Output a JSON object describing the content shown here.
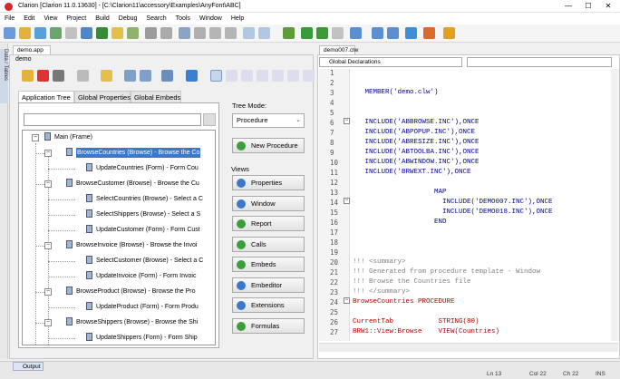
{
  "window": {
    "title": "Clarion [Clarion 11.0.13630] - [C:\\Clarion11\\accessory\\Examples\\AnyFont\\ABC]",
    "min": "—",
    "max": "☐",
    "close": "✕"
  },
  "menu": [
    "File",
    "Edit",
    "View",
    "Project",
    "Build",
    "Debug",
    "Search",
    "Tools",
    "Window",
    "Help"
  ],
  "sidebar": {
    "label": "Data / Tables"
  },
  "left_doc": {
    "tab": "demo.app",
    "subtitle": "demo"
  },
  "tabs": [
    "Application Tree",
    "Global Properties",
    "Global Embeds"
  ],
  "tree": {
    "root": "Main (Frame)",
    "items": [
      {
        "label": "BrowseCountries (Browse) - Browse the Co",
        "level": 1,
        "selected": true
      },
      {
        "label": "UpdateCountries (Form) - Form Cou",
        "level": 2
      },
      {
        "label": "BrowseCustomer (Browse) - Browse the Cu",
        "level": 1
      },
      {
        "label": "SelectCountries (Browse) - Select a C",
        "level": 2
      },
      {
        "label": "SelectShippers (Browse) - Select a S",
        "level": 2
      },
      {
        "label": "UpdateCustomer (Form) - Form Cust",
        "level": 2
      },
      {
        "label": "BrowseInvoice (Browse) - Browse the Invoi",
        "level": 1
      },
      {
        "label": "SelectCustomer (Browse) - Select a C",
        "level": 2
      },
      {
        "label": "UpdateInvoice (Form) - Form Invoic",
        "level": 2
      },
      {
        "label": "BrowseProduct (Browse) - Browse the Pro",
        "level": 1
      },
      {
        "label": "UpdateProduct (Form) - Form Produ",
        "level": 2
      },
      {
        "label": "BrowseShippers (Browse) - Browse the Shi",
        "level": 1
      },
      {
        "label": "UpdateShippers (Form) - Form Ship",
        "level": 2
      }
    ]
  },
  "tree_mode": {
    "label": "Tree Mode:",
    "value": "Procedure"
  },
  "new_procedure": "New Procedure",
  "views": {
    "label": "Views",
    "buttons": [
      "Properties",
      "Window",
      "Report",
      "Calls",
      "Embeds",
      "Embeditor",
      "Extensions",
      "Formulas"
    ]
  },
  "editor": {
    "tab": "demo007.clw",
    "combo": "Global Declarations",
    "lines": [
      {
        "n": "1",
        "text": "",
        "cls": ""
      },
      {
        "n": "2",
        "text": "",
        "cls": ""
      },
      {
        "n": "3",
        "text": "   MEMBER('demo.clw')",
        "cls": ""
      },
      {
        "n": "4",
        "text": "",
        "cls": ""
      },
      {
        "n": "5",
        "text": "",
        "cls": ""
      },
      {
        "n": "6",
        "text": "   INCLUDE('ABBROWSE.INC'),ONCE",
        "cls": ""
      },
      {
        "n": "7",
        "text": "   INCLUDE('ABPOPUP.INC'),ONCE",
        "cls": ""
      },
      {
        "n": "8",
        "text": "   INCLUDE('ABRESIZE.INC'),ONCE",
        "cls": ""
      },
      {
        "n": "9",
        "text": "   INCLUDE('ABTOOLBA.INC'),ONCE",
        "cls": ""
      },
      {
        "n": "10",
        "text": "   INCLUDE('ABWINDOW.INC'),ONCE",
        "cls": ""
      },
      {
        "n": "11",
        "text": "   INCLUDE('BRWEXT.INC'),ONCE",
        "cls": ""
      },
      {
        "n": "12",
        "text": "",
        "cls": ""
      },
      {
        "n": "13",
        "text": "                    MAP",
        "cls": ""
      },
      {
        "n": "14",
        "text": "                      INCLUDE('DEMO007.INC'),ONCE",
        "cls": ""
      },
      {
        "n": "15",
        "text": "                      INCLUDE('DEMO018.INC'),ONCE",
        "cls": ""
      },
      {
        "n": "16",
        "text": "                    END",
        "cls": ""
      },
      {
        "n": "17",
        "text": "",
        "cls": ""
      },
      {
        "n": "18",
        "text": "",
        "cls": ""
      },
      {
        "n": "19",
        "text": "",
        "cls": ""
      },
      {
        "n": "20",
        "text": "!!! <summary>",
        "cls": "cm"
      },
      {
        "n": "21",
        "text": "!!! Generated from procedure template - Window",
        "cls": "cm"
      },
      {
        "n": "22",
        "text": "!!! Browse the Countries file",
        "cls": "cm"
      },
      {
        "n": "23",
        "text": "!!! </summary>",
        "cls": "cm"
      },
      {
        "n": "24",
        "text": "BrowseCountries PROCEDURE",
        "cls": "kw"
      },
      {
        "n": "25",
        "text": "",
        "cls": ""
      },
      {
        "n": "26",
        "text": "CurrentTab           STRING(80)",
        "cls": "kw"
      },
      {
        "n": "27",
        "text": "BRW1::View:Browse    VIEW(Countries)",
        "cls": "kw"
      }
    ]
  },
  "status": {
    "output": "Output",
    "ln": "Ln 13",
    "col": "Col 22",
    "ch": "Ch 22",
    "mode": "INS"
  }
}
